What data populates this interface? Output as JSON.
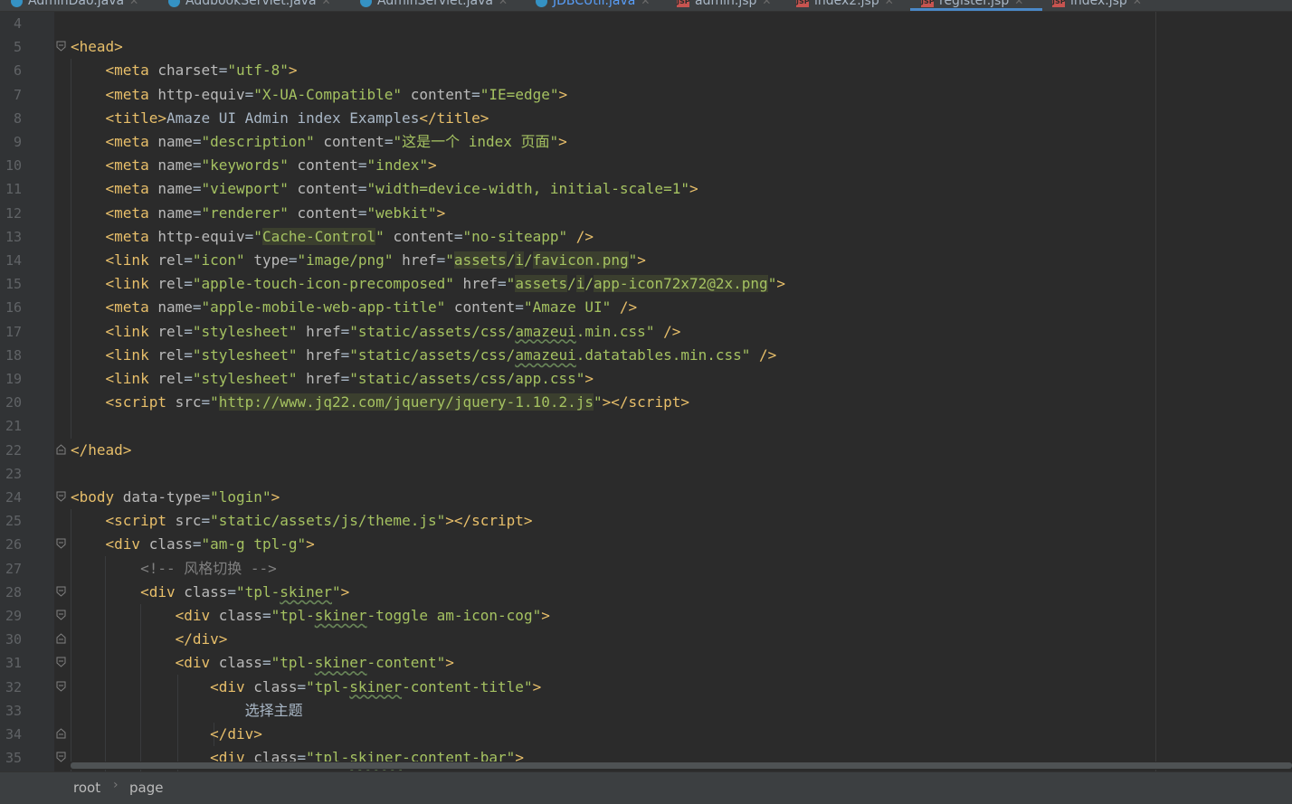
{
  "tabs": [
    {
      "name": "AdminDao.java",
      "icon": "java-class-icon",
      "active": false
    },
    {
      "name": "AddbookServlet.java",
      "icon": "java-class-icon",
      "active": false
    },
    {
      "name": "AdminServlet.java",
      "icon": "java-class-icon",
      "active": false
    },
    {
      "name": "JDBCUtil.java",
      "icon": "java-class-icon",
      "active": false
    },
    {
      "name": "admin.jsp",
      "icon": "jsp-file-icon",
      "active": false
    },
    {
      "name": "index2.jsp",
      "icon": "jsp-file-icon",
      "active": false
    },
    {
      "name": "register.jsp",
      "icon": "jsp-file-icon",
      "active": true
    },
    {
      "name": "index.jsp",
      "icon": "jsp-file-icon",
      "active": false
    }
  ],
  "line_numbers": [
    "4",
    "5",
    "6",
    "7",
    "8",
    "9",
    "10",
    "11",
    "12",
    "13",
    "14",
    "15",
    "16",
    "17",
    "18",
    "19",
    "20",
    "21",
    "22",
    "23",
    "24",
    "25",
    "26",
    "27",
    "28",
    "29",
    "30",
    "31",
    "32",
    "33",
    "34",
    "35"
  ],
  "breadcrumb": {
    "items": [
      "root",
      "page"
    ],
    "separator": "›"
  },
  "colors": {
    "background": "#2b2b2b",
    "tag": "#e8bf6a",
    "attribute": "#bababa",
    "value": "#a5c261",
    "text": "#a9b7c6",
    "comment": "#808080"
  }
}
